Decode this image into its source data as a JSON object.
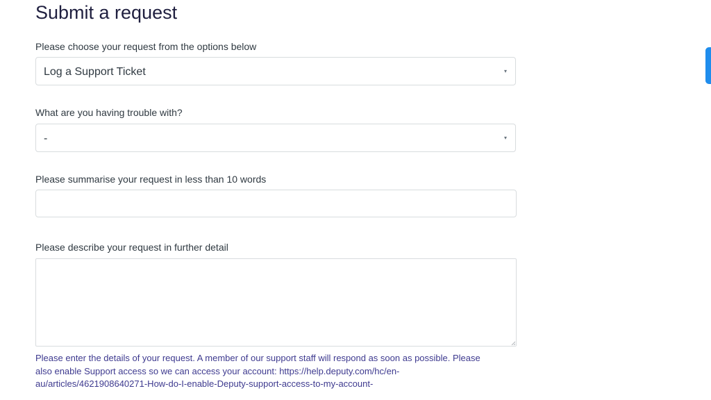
{
  "form": {
    "title": "Submit a request",
    "request_type": {
      "label": "Please choose your request from the options below",
      "value": "Log a Support Ticket",
      "arrow": "▾"
    },
    "trouble": {
      "label": "What are you having trouble with?",
      "value": "-",
      "arrow": "▾"
    },
    "summary": {
      "label": "Please summarise your request in less than 10 words",
      "value": ""
    },
    "description": {
      "label": "Please describe your request in further detail",
      "value": "",
      "hint_lines": [
        "Please enter the details of your request. A member of our support staff will respond as soon as possible. Please",
        "also enable Support access so we can access your account: https://help.deputy.com/hc/en-",
        "au/articles/4621908640271-How-do-I-enable-Deputy-support-access-to-my-account-"
      ]
    }
  },
  "colors": {
    "accent": "#1f8ded",
    "hint_text": "#3e3a8f",
    "border": "#d8dcde"
  }
}
